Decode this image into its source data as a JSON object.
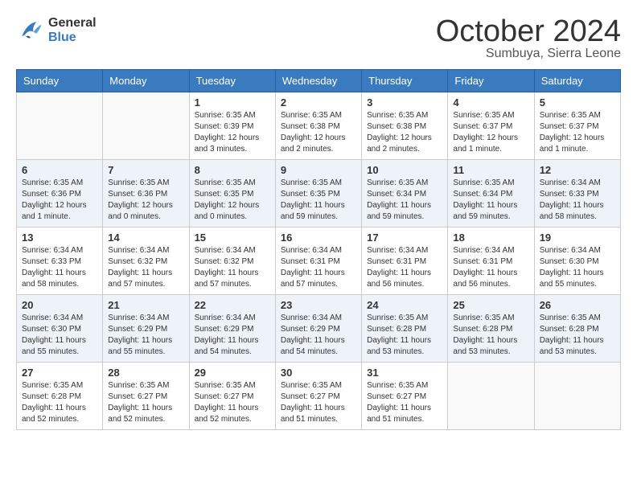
{
  "header": {
    "logo_line1": "General",
    "logo_line2": "Blue",
    "month": "October 2024",
    "location": "Sumbuya, Sierra Leone"
  },
  "weekdays": [
    "Sunday",
    "Monday",
    "Tuesday",
    "Wednesday",
    "Thursday",
    "Friday",
    "Saturday"
  ],
  "weeks": [
    [
      {
        "day": "",
        "info": ""
      },
      {
        "day": "",
        "info": ""
      },
      {
        "day": "1",
        "info": "Sunrise: 6:35 AM\nSunset: 6:39 PM\nDaylight: 12 hours and 3 minutes."
      },
      {
        "day": "2",
        "info": "Sunrise: 6:35 AM\nSunset: 6:38 PM\nDaylight: 12 hours and 2 minutes."
      },
      {
        "day": "3",
        "info": "Sunrise: 6:35 AM\nSunset: 6:38 PM\nDaylight: 12 hours and 2 minutes."
      },
      {
        "day": "4",
        "info": "Sunrise: 6:35 AM\nSunset: 6:37 PM\nDaylight: 12 hours and 1 minute."
      },
      {
        "day": "5",
        "info": "Sunrise: 6:35 AM\nSunset: 6:37 PM\nDaylight: 12 hours and 1 minute."
      }
    ],
    [
      {
        "day": "6",
        "info": "Sunrise: 6:35 AM\nSunset: 6:36 PM\nDaylight: 12 hours and 1 minute."
      },
      {
        "day": "7",
        "info": "Sunrise: 6:35 AM\nSunset: 6:36 PM\nDaylight: 12 hours and 0 minutes."
      },
      {
        "day": "8",
        "info": "Sunrise: 6:35 AM\nSunset: 6:35 PM\nDaylight: 12 hours and 0 minutes."
      },
      {
        "day": "9",
        "info": "Sunrise: 6:35 AM\nSunset: 6:35 PM\nDaylight: 11 hours and 59 minutes."
      },
      {
        "day": "10",
        "info": "Sunrise: 6:35 AM\nSunset: 6:34 PM\nDaylight: 11 hours and 59 minutes."
      },
      {
        "day": "11",
        "info": "Sunrise: 6:35 AM\nSunset: 6:34 PM\nDaylight: 11 hours and 59 minutes."
      },
      {
        "day": "12",
        "info": "Sunrise: 6:34 AM\nSunset: 6:33 PM\nDaylight: 11 hours and 58 minutes."
      }
    ],
    [
      {
        "day": "13",
        "info": "Sunrise: 6:34 AM\nSunset: 6:33 PM\nDaylight: 11 hours and 58 minutes."
      },
      {
        "day": "14",
        "info": "Sunrise: 6:34 AM\nSunset: 6:32 PM\nDaylight: 11 hours and 57 minutes."
      },
      {
        "day": "15",
        "info": "Sunrise: 6:34 AM\nSunset: 6:32 PM\nDaylight: 11 hours and 57 minutes."
      },
      {
        "day": "16",
        "info": "Sunrise: 6:34 AM\nSunset: 6:31 PM\nDaylight: 11 hours and 57 minutes."
      },
      {
        "day": "17",
        "info": "Sunrise: 6:34 AM\nSunset: 6:31 PM\nDaylight: 11 hours and 56 minutes."
      },
      {
        "day": "18",
        "info": "Sunrise: 6:34 AM\nSunset: 6:31 PM\nDaylight: 11 hours and 56 minutes."
      },
      {
        "day": "19",
        "info": "Sunrise: 6:34 AM\nSunset: 6:30 PM\nDaylight: 11 hours and 55 minutes."
      }
    ],
    [
      {
        "day": "20",
        "info": "Sunrise: 6:34 AM\nSunset: 6:30 PM\nDaylight: 11 hours and 55 minutes."
      },
      {
        "day": "21",
        "info": "Sunrise: 6:34 AM\nSunset: 6:29 PM\nDaylight: 11 hours and 55 minutes."
      },
      {
        "day": "22",
        "info": "Sunrise: 6:34 AM\nSunset: 6:29 PM\nDaylight: 11 hours and 54 minutes."
      },
      {
        "day": "23",
        "info": "Sunrise: 6:34 AM\nSunset: 6:29 PM\nDaylight: 11 hours and 54 minutes."
      },
      {
        "day": "24",
        "info": "Sunrise: 6:35 AM\nSunset: 6:28 PM\nDaylight: 11 hours and 53 minutes."
      },
      {
        "day": "25",
        "info": "Sunrise: 6:35 AM\nSunset: 6:28 PM\nDaylight: 11 hours and 53 minutes."
      },
      {
        "day": "26",
        "info": "Sunrise: 6:35 AM\nSunset: 6:28 PM\nDaylight: 11 hours and 53 minutes."
      }
    ],
    [
      {
        "day": "27",
        "info": "Sunrise: 6:35 AM\nSunset: 6:28 PM\nDaylight: 11 hours and 52 minutes."
      },
      {
        "day": "28",
        "info": "Sunrise: 6:35 AM\nSunset: 6:27 PM\nDaylight: 11 hours and 52 minutes."
      },
      {
        "day": "29",
        "info": "Sunrise: 6:35 AM\nSunset: 6:27 PM\nDaylight: 11 hours and 52 minutes."
      },
      {
        "day": "30",
        "info": "Sunrise: 6:35 AM\nSunset: 6:27 PM\nDaylight: 11 hours and 51 minutes."
      },
      {
        "day": "31",
        "info": "Sunrise: 6:35 AM\nSunset: 6:27 PM\nDaylight: 11 hours and 51 minutes."
      },
      {
        "day": "",
        "info": ""
      },
      {
        "day": "",
        "info": ""
      }
    ]
  ]
}
